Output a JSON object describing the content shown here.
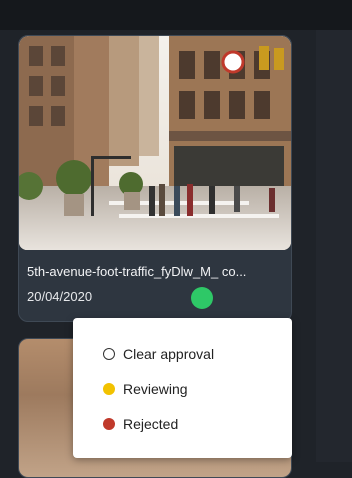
{
  "card": {
    "title": "5th-avenue-foot-traffic_fyDlw_M_ co...",
    "date": "20/04/2020",
    "status_color": "#2ec867"
  },
  "menu": {
    "items": [
      {
        "label": "Clear approval",
        "icon": "empty-circle-icon",
        "color": "#ffffff"
      },
      {
        "label": "Reviewing",
        "icon": "yellow-dot-icon",
        "color": "#f2c200"
      },
      {
        "label": "Rejected",
        "icon": "red-dot-icon",
        "color": "#c0392b"
      }
    ]
  }
}
